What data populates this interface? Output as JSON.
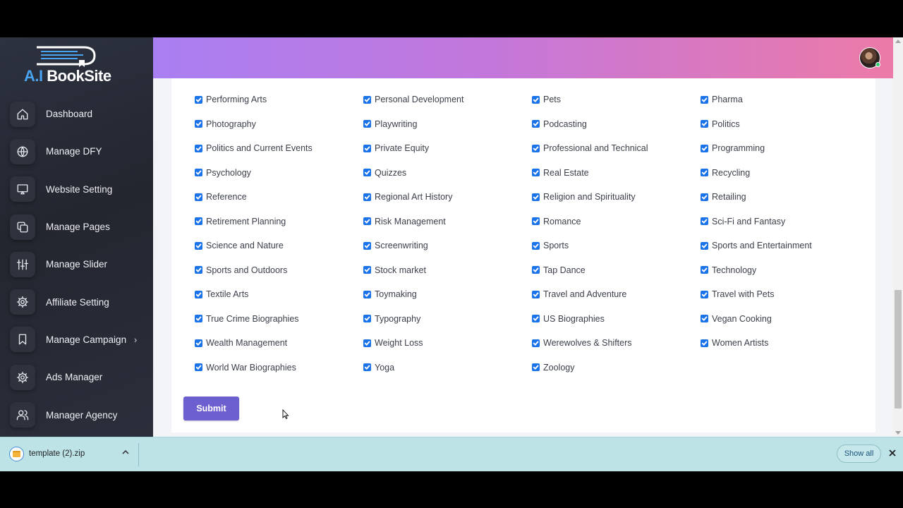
{
  "brand": {
    "ai_text": "A.I",
    "site_text": "BookSite"
  },
  "sidebar": {
    "items": [
      {
        "label": "Dashboard",
        "icon": "home-icon"
      },
      {
        "label": "Manage DFY",
        "icon": "globe-icon"
      },
      {
        "label": "Website Setting",
        "icon": "monitor-icon"
      },
      {
        "label": "Manage Pages",
        "icon": "copy-icon"
      },
      {
        "label": "Manage Slider",
        "icon": "sliders-icon"
      },
      {
        "label": "Affiliate Setting",
        "icon": "gear-icon"
      },
      {
        "label": "Manage Campaign",
        "icon": "bookmark-icon",
        "has_submenu": true
      },
      {
        "label": "Ads Manager",
        "icon": "gear-icon"
      },
      {
        "label": "Manager Agency",
        "icon": "users-icon"
      }
    ]
  },
  "categories": {
    "columns": [
      [
        "Performing Arts",
        "Photography",
        "Politics and Current Events",
        "Psychology",
        "Reference",
        "Retirement Planning",
        "Science and Nature",
        "Sports and Outdoors",
        "Textile Arts",
        "True Crime Biographies",
        "Wealth Management",
        "World War Biographies"
      ],
      [
        "Personal Development",
        "Playwriting",
        "Private Equity",
        "Quizzes",
        "Regional Art History",
        "Risk Management",
        "Screenwriting",
        "Stock market",
        "Toymaking",
        "Typography",
        "Weight Loss",
        "Yoga"
      ],
      [
        "Pets",
        "Podcasting",
        "Professional and Technical",
        "Real Estate",
        "Religion and Spirituality",
        "Romance",
        "Sports",
        "Tap Dance",
        "Travel and Adventure",
        "US Biographies",
        "Werewolves & Shifters",
        "Zoology"
      ],
      [
        "Pharma",
        "Politics",
        "Programming",
        "Recycling",
        "Retailing",
        "Sci-Fi and Fantasy",
        "Sports and Entertainment",
        "Technology",
        "Travel with Pets",
        "Vegan Cooking",
        "Women Artists"
      ]
    ],
    "all_checked": true
  },
  "form": {
    "submit_label": "Submit"
  },
  "downloads": {
    "file_name": "template (2).zip",
    "show_all_label": "Show all"
  },
  "colors": {
    "checkbox": "#1a73e8",
    "submit": "#6c5fcf",
    "header_start": "#a97ff2",
    "header_end": "#ec7aa8"
  }
}
